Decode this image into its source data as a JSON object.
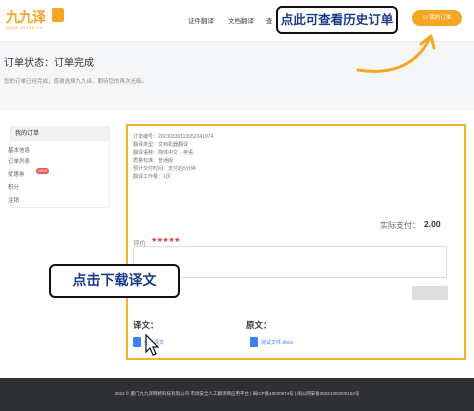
{
  "header": {
    "logo_text": "九九译",
    "logo_sub": "WWW.99YEE.CN",
    "nav": [
      {
        "label": "证件翻译"
      },
      {
        "label": "文档翻译"
      },
      {
        "label": "查"
      }
    ],
    "my_order_label": "我的订单",
    "accent_color": "#f5a623"
  },
  "callouts": {
    "top": "点此可查看历史订单",
    "bottom": "点击下载译文"
  },
  "status": {
    "title": "订单状态：订单完成",
    "message": "您的订单已经完成，感谢选择九九译，期待您的再次光临。"
  },
  "sidebar": {
    "heading": "我的订单",
    "items": [
      {
        "label": "基本信息"
      },
      {
        "label": "订单列表"
      },
      {
        "label": "优惠券"
      },
      {
        "label": "积分"
      },
      {
        "label": "注销"
      }
    ],
    "coupon_tag": "NEW"
  },
  "order": {
    "info": [
      "订单编号：20230330113652341974",
      "翻译类型：文档机器翻译",
      "翻译语种：简体中文→英语",
      "质量标准：普通版",
      "预计交付时间：支付后5分钟",
      "翻译工作量：1页"
    ],
    "pay_label": "实际支付：",
    "pay_value": "2.00",
    "review_label": "评价",
    "stars": "★★★★★",
    "translation_label": "译文：",
    "translation_file": "英文译文",
    "original_label": "原文：",
    "original_file": "测试文件.docx"
  },
  "footer": {
    "text": "2022 © 厦门九九译网络科技有限公司-市场安全人工翻译网应用平台 | 闽ICP备18030974号 | 闽公网安备35021302000162号"
  }
}
